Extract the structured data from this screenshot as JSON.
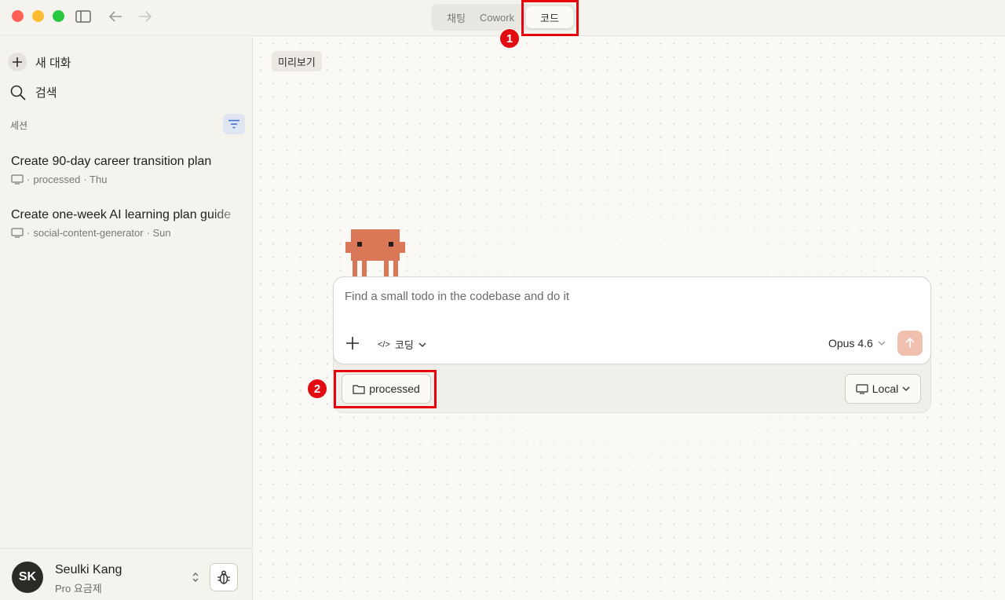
{
  "titlebar": {
    "tabs": [
      {
        "label": "채팅"
      },
      {
        "label": "Cowork"
      },
      {
        "label": "코드"
      }
    ],
    "annotations": [
      "1",
      "2"
    ]
  },
  "sidebar": {
    "new_chat": "새 대화",
    "search": "검색",
    "section": "세션",
    "sessions": [
      {
        "title": "Create 90-day career transition plan",
        "project": "processed",
        "when": "· Thu"
      },
      {
        "title": "Create one-week AI learning plan guide",
        "project": "social-content-generator",
        "when": "· Sun"
      }
    ],
    "user": {
      "initials": "SK",
      "name": "Seulki Kang",
      "plan": "Pro 요금제"
    }
  },
  "main": {
    "preview": "미리보기",
    "composer": {
      "placeholder": "Find a small todo in the codebase and do it",
      "mode": "코딩",
      "model": "Opus 4.6"
    },
    "folder": "processed",
    "environment": "Local"
  },
  "colors": {
    "accent": "#d97757",
    "highlight": "#e8000b",
    "send_disabled": "#f1bfae"
  }
}
